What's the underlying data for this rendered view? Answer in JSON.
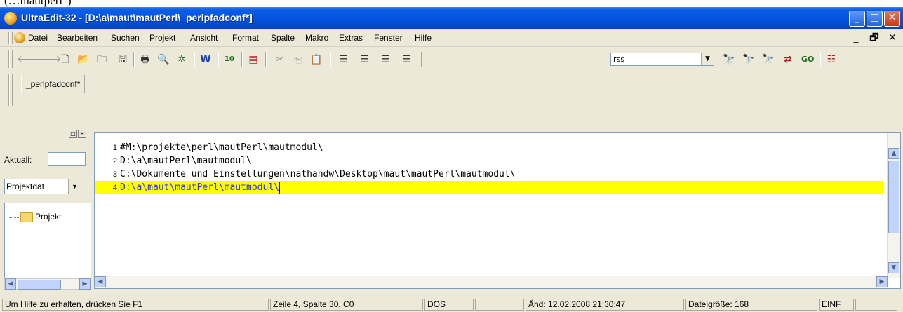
{
  "top_text": "(…mautperl\")",
  "window": {
    "title": "UltraEdit-32 - [D:\\a\\maut\\mautPerl\\_perlpfadconf*]",
    "controls": {
      "minimize": "_",
      "maximize": "□",
      "close": "✕"
    }
  },
  "menu": {
    "items": [
      "Datei",
      "Bearbeiten",
      "Suchen",
      "Projekt",
      "Ansicht",
      "Format",
      "Spalte",
      "Makro",
      "Extras",
      "Fenster",
      "Hilfe"
    ],
    "mdi_controls": {
      "minimize": "_",
      "restore": "🗗",
      "close": "✕"
    }
  },
  "toolbar": {
    "search_combo_value": "rss"
  },
  "tabs": [
    {
      "label": "_perlpfadconf*"
    }
  ],
  "sidebar": {
    "aktual_label": "Aktuali:",
    "project_combo_value": "Projektdat",
    "tree_root": "Projekt"
  },
  "editor": {
    "lines": [
      {
        "num": "1",
        "text": "#M:\\projekte\\perl\\mautPerl\\mautmodul\\"
      },
      {
        "num": "2",
        "text": "D:\\a\\mautPerl\\mautmodul\\"
      },
      {
        "num": "3",
        "text": "C:\\Dokumente und Einstellungen\\nathandw\\Desktop\\maut\\mautPerl\\mautmodul\\"
      },
      {
        "num": "4",
        "text": "D:\\a\\maut\\mautPerl\\mautmodul\\"
      }
    ],
    "active_line_color": "#ffff00"
  },
  "status": {
    "help": "Um Hilfe zu erhalten, drücken Sie F1",
    "position": "Zeile 4, Spalte 30, C0",
    "format": "DOS",
    "modified": "Änd: 12.02.2008 21:30:47",
    "size": "Dateigröße: 168",
    "mode": "EINF"
  }
}
